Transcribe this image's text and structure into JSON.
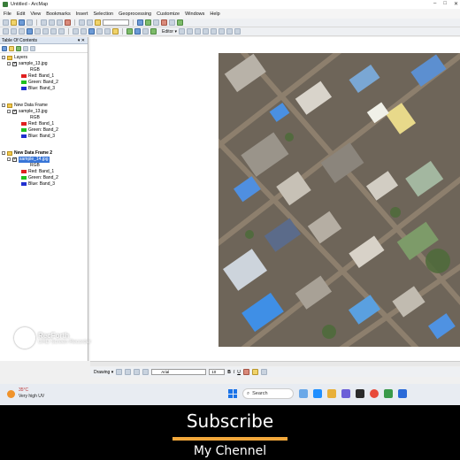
{
  "window": {
    "title": "Untitled - ArcMap",
    "controls": [
      "–",
      "□",
      "✕"
    ]
  },
  "menu": [
    "File",
    "Edit",
    "View",
    "Bookmarks",
    "Insert",
    "Selection",
    "Geoprocessing",
    "Customize",
    "Windows",
    "Help"
  ],
  "toolbar": {
    "editor_label": "Editor ▾"
  },
  "toc": {
    "title": "Table Of Contents",
    "pin": "▾ ✕",
    "frames": [
      {
        "name": "Layers",
        "image": "sample_13.jpg",
        "rgb": "RGB",
        "bands": [
          {
            "channel": "Red:",
            "band": "Band_1"
          },
          {
            "channel": "Green:",
            "band": "Band_2"
          },
          {
            "channel": "Blue:",
            "band": "Band_3"
          }
        ]
      },
      {
        "name": "New Data Frame",
        "image": "sample_13.jpg",
        "rgb": "RGB",
        "bands": [
          {
            "channel": "Red:",
            "band": "Band_1"
          },
          {
            "channel": "Green:",
            "band": "Band_2"
          },
          {
            "channel": "Blue:",
            "band": "Band_3"
          }
        ]
      },
      {
        "name": "New Data Frame 2",
        "image": "sample_14.jpg",
        "rgb": "RGB",
        "bands": [
          {
            "channel": "Red:",
            "band": "Band_1"
          },
          {
            "channel": "Green:",
            "band": "Band_2"
          },
          {
            "channel": "Blue:",
            "band": "Band_3"
          }
        ]
      }
    ],
    "band_colors": [
      "#e02020",
      "#20c020",
      "#2030d0"
    ]
  },
  "drawing": {
    "label": "Drawing ▾",
    "font": "Arial",
    "size": "10",
    "bold": "B",
    "italic": "I",
    "underline": "U"
  },
  "watermark": {
    "brand": "RecForth",
    "sub": "UHD Screen Recorder"
  },
  "taskbar": {
    "temperature": "35°C",
    "condition": "Very high UV",
    "search_placeholder": "Search"
  },
  "banner": {
    "title": "Subscribe",
    "channel": "My Chennel"
  }
}
